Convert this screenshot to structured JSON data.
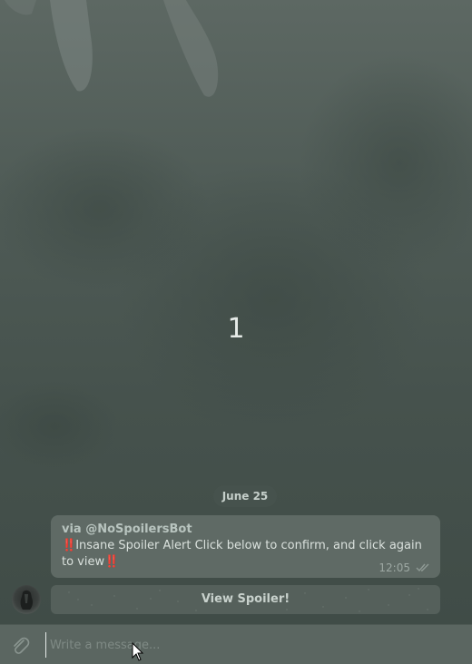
{
  "overlay": {
    "counter": "1"
  },
  "chat": {
    "date_label": "June 25",
    "message": {
      "via": "via @NoSpoilersBot",
      "bang_start": "‼️",
      "text": "Insane Spoiler Alert Click below to confirm, and click again to view",
      "bang_end": "‼️",
      "time": "12:05",
      "status_icon": "double-check-icon"
    },
    "inline_button": {
      "label": "View Spoiler!"
    }
  },
  "composer": {
    "placeholder": "Write a message...",
    "attach_icon": "paperclip-icon"
  },
  "colors": {
    "background": "#46524d",
    "bubble": "#5f6a65",
    "alert_accent": "#9b3a37"
  }
}
